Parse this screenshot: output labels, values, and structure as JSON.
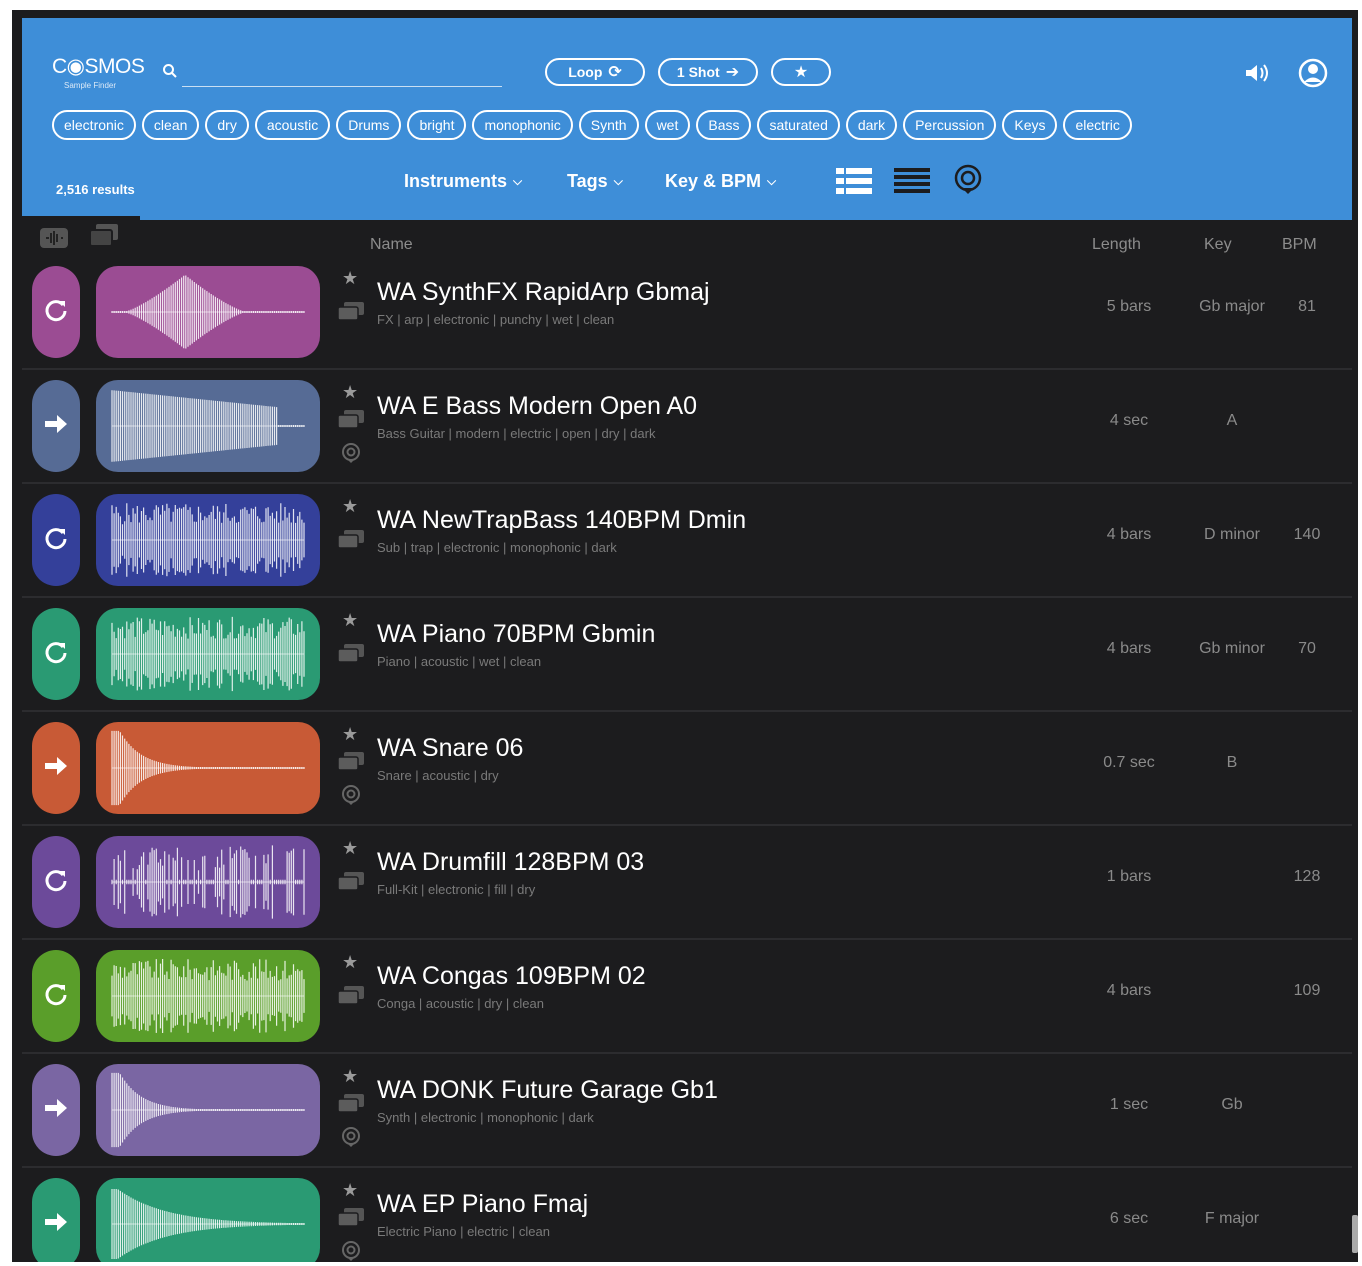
{
  "header": {
    "logo": "C◉SMOS",
    "logo_sub": "Sample Finder",
    "search_placeholder": "",
    "loop_label": "Loop",
    "oneshot_label": "1 Shot",
    "tags": [
      "electronic",
      "clean",
      "dry",
      "acoustic",
      "Drums",
      "bright",
      "monophonic",
      "Synth",
      "wet",
      "Bass",
      "saturated",
      "dark",
      "Percussion",
      "Keys",
      "electric"
    ],
    "results": "2,516 results",
    "filters": [
      "Instruments",
      "Tags",
      "Key & BPM"
    ]
  },
  "columns": {
    "name": "Name",
    "length": "Length",
    "key": "Key",
    "bpm": "BPM"
  },
  "colors": {
    "header": "#3e8ed8",
    "background": "#1c1c1e"
  },
  "rows": [
    {
      "title": "WA SynthFX RapidArp Gbmaj",
      "tags": "FX | arp | electronic | punchy | wet | clean",
      "length": "5 bars",
      "key": "Gb major",
      "bpm": "81",
      "type": "loop",
      "color": "#9b4c93",
      "wave": "diamond",
      "has_target": false
    },
    {
      "title": "WA E Bass Modern Open A0",
      "tags": "Bass Guitar | modern | electric | open | dry | dark",
      "length": "4 sec",
      "key": "A",
      "bpm": "",
      "type": "oneshot",
      "color": "#566b95",
      "wave": "decay-long",
      "has_target": true
    },
    {
      "title": "WA NewTrapBass 140BPM Dmin",
      "tags": "Sub | trap | electronic | monophonic | dark",
      "length": "4 bars",
      "key": "D minor",
      "bpm": "140",
      "type": "loop",
      "color": "#34409a",
      "wave": "dense",
      "has_target": false
    },
    {
      "title": "WA Piano 70BPM Gbmin",
      "tags": "Piano | acoustic | wet | clean",
      "length": "4 bars",
      "key": "Gb minor",
      "bpm": "70",
      "type": "loop",
      "color": "#2a9a73",
      "wave": "dense",
      "has_target": false
    },
    {
      "title": "WA Snare 06",
      "tags": "Snare | acoustic | dry",
      "length": "0.7 sec",
      "key": "B",
      "bpm": "",
      "type": "oneshot",
      "color": "#c85a36",
      "wave": "decay-short",
      "has_target": true
    },
    {
      "title": "WA Drumfill 128BPM 03",
      "tags": "Full-Kit | electronic | fill | dry",
      "length": "1 bars",
      "key": "",
      "bpm": "128",
      "type": "loop",
      "color": "#6c4a9a",
      "wave": "sparse",
      "has_target": false
    },
    {
      "title": "WA Congas 109BPM 02",
      "tags": "Conga | acoustic | dry | clean",
      "length": "4 bars",
      "key": "",
      "bpm": "109",
      "type": "loop",
      "color": "#5a9e2a",
      "wave": "dense",
      "has_target": false
    },
    {
      "title": "WA DONK Future Garage Gb1",
      "tags": "Synth | electronic | monophonic | dark",
      "length": "1 sec",
      "key": "Gb",
      "bpm": "",
      "type": "oneshot",
      "color": "#7a66a3",
      "wave": "decay-short",
      "has_target": true
    },
    {
      "title": "WA EP Piano Fmaj",
      "tags": "Electric Piano | electric | clean",
      "length": "6 sec",
      "key": "F major",
      "bpm": "",
      "type": "oneshot",
      "color": "#2a9a73",
      "wave": "decay-mid",
      "has_target": true
    }
  ]
}
